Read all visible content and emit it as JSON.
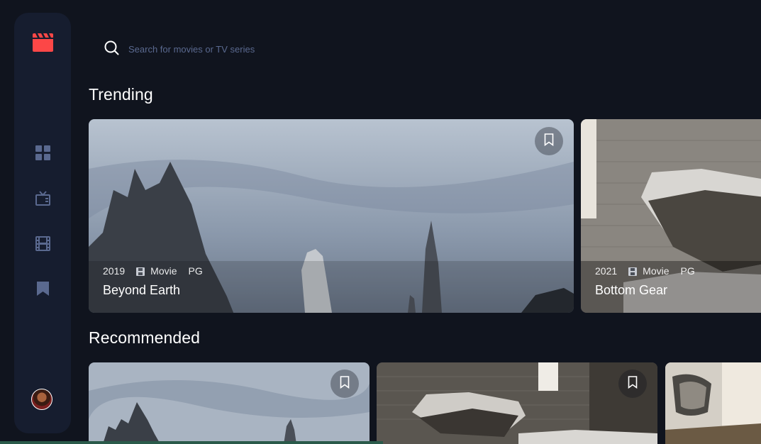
{
  "sidebar": {
    "logo_icon": "clapperboard-icon",
    "nav": [
      {
        "name": "home",
        "icon": "grid-icon"
      },
      {
        "name": "tv-series",
        "icon": "tv-icon"
      },
      {
        "name": "movies",
        "icon": "film-icon"
      },
      {
        "name": "bookmarks",
        "icon": "bookmark-icon"
      }
    ],
    "accent_color": "#fc4747",
    "icon_color": "#5a698f"
  },
  "search": {
    "placeholder": "Search for movies or TV series"
  },
  "trending": {
    "title": "Trending",
    "items": [
      {
        "year": "2019",
        "category": "Movie",
        "rating": "PG",
        "title": "Beyond Earth"
      },
      {
        "year": "2021",
        "category": "Movie",
        "rating": "PG",
        "title": "Bottom Gear"
      }
    ]
  },
  "recommended": {
    "title": "Recommended"
  },
  "colors": {
    "background": "#10141e",
    "surface": "#161d2f"
  }
}
